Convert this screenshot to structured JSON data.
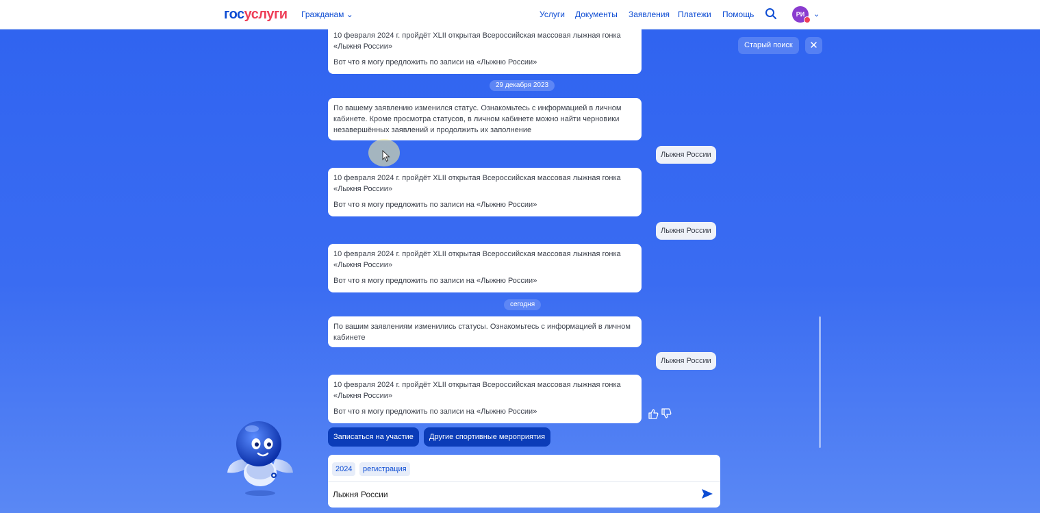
{
  "header": {
    "logo_part1": "гос",
    "logo_part2": "услуги",
    "citizens_menu": "Гражданам",
    "nav": [
      "Услуги",
      "Документы",
      "Заявления",
      "Платежи",
      "Помощь"
    ],
    "avatar_initials": "РИ",
    "colors": {
      "brand_blue": "#0d4cd3",
      "brand_red": "#ee3f58"
    }
  },
  "controls": {
    "old_search": "Старый поиск",
    "close": "✕"
  },
  "chat": {
    "messages": [
      {
        "from": "bot",
        "lines": [
          "10 февраля 2024 г. пройдёт XLII открытая Всероссийская массовая лыжная гонка «Лыжня России»",
          "Вот что я могу предложить по записи на «Лыжню России»"
        ]
      },
      {
        "date": "29 декабря 2023"
      },
      {
        "from": "bot",
        "lines": [
          "По вашему заявлению изменился статус. Ознакомьтесь с информацией в личном кабинете. Кроме просмотра статусов, в личном кабинете можно найти черновики незавершённых заявлений и продолжить их заполнение"
        ]
      },
      {
        "from": "user",
        "text": "Лыжня России"
      },
      {
        "from": "bot",
        "lines": [
          "10 февраля 2024 г. пройдёт XLII открытая Всероссийская массовая лыжная гонка «Лыжня России»",
          "Вот что я могу предложить по записи на «Лыжню России»"
        ]
      },
      {
        "from": "user",
        "text": "Лыжня России"
      },
      {
        "from": "bot",
        "lines": [
          "10 февраля 2024 г. пройдёт XLII открытая Всероссийская массовая лыжная гонка «Лыжня России»",
          "Вот что я могу предложить по записи на «Лыжню России»"
        ]
      },
      {
        "date": "сегодня"
      },
      {
        "from": "bot",
        "lines": [
          "По вашим заявлениям изменились статусы. Ознакомьтесь с информацией в личном кабинете"
        ]
      },
      {
        "from": "user",
        "text": "Лыжня России"
      },
      {
        "from": "bot",
        "lines": [
          "10 февраля 2024 г. пройдёт XLII открытая Всероссийская массовая лыжная гонка «Лыжня России»",
          "Вот что я могу предложить по записи на «Лыжню России»"
        ]
      }
    ],
    "actions": [
      "Записаться на участие",
      "Другие спортивные мероприятия"
    ]
  },
  "input": {
    "chips": [
      "2024",
      "регистрация"
    ],
    "value": "Лыжня России"
  },
  "icons": [
    "search-icon",
    "chevron-down-icon",
    "close-icon",
    "thumbs-up-icon",
    "thumbs-down-icon",
    "send-icon",
    "robot-mascot-icon",
    "cursor-icon"
  ]
}
